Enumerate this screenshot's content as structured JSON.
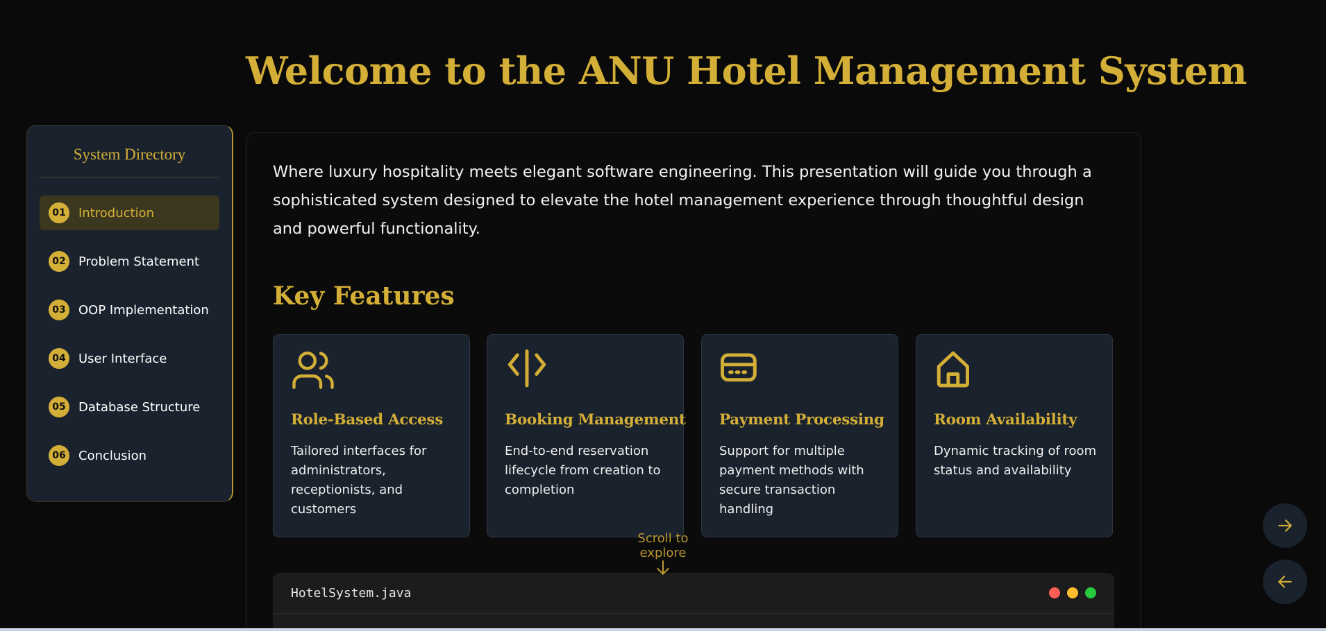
{
  "page": {
    "title": "Welcome to the ANU Hotel Management System"
  },
  "sidebar": {
    "title": "System Directory",
    "items": [
      {
        "num": "01",
        "label": "Introduction",
        "active": true
      },
      {
        "num": "02",
        "label": "Problem Statement"
      },
      {
        "num": "03",
        "label": "OOP Implementation"
      },
      {
        "num": "04",
        "label": "User Interface"
      },
      {
        "num": "05",
        "label": "Database Structure"
      },
      {
        "num": "06",
        "label": "Conclusion"
      }
    ]
  },
  "main": {
    "intro": "Where luxury hospitality meets elegant software engineering. This presentation will guide you through a sophisticated system designed to elevate the hotel management experience through thoughtful design and powerful functionality.",
    "features_title": "Key Features",
    "features": [
      {
        "icon": "users-icon",
        "title": "Role-Based Access",
        "desc": "Tailored interfaces for administrators, receptionists, and customers"
      },
      {
        "icon": "code-icon",
        "title": "Booking Management",
        "desc": "End-to-end reservation lifecycle from creation to completion"
      },
      {
        "icon": "credit-card-icon",
        "title": "Payment Processing",
        "desc": "Support for multiple payment methods with secure transaction handling"
      },
      {
        "icon": "home-icon",
        "title": "Room Availability",
        "desc": "Dynamic tracking of room status and availability"
      }
    ],
    "code_window": {
      "filename": "HotelSystem.java",
      "dots": [
        "#ff5f56",
        "#ffbd2e",
        "#27c93f"
      ]
    }
  },
  "scroll_hint": "Scroll to explore",
  "colors": {
    "accent": "#d4af37",
    "background": "#0a0a0a",
    "card": "#1a222d"
  }
}
